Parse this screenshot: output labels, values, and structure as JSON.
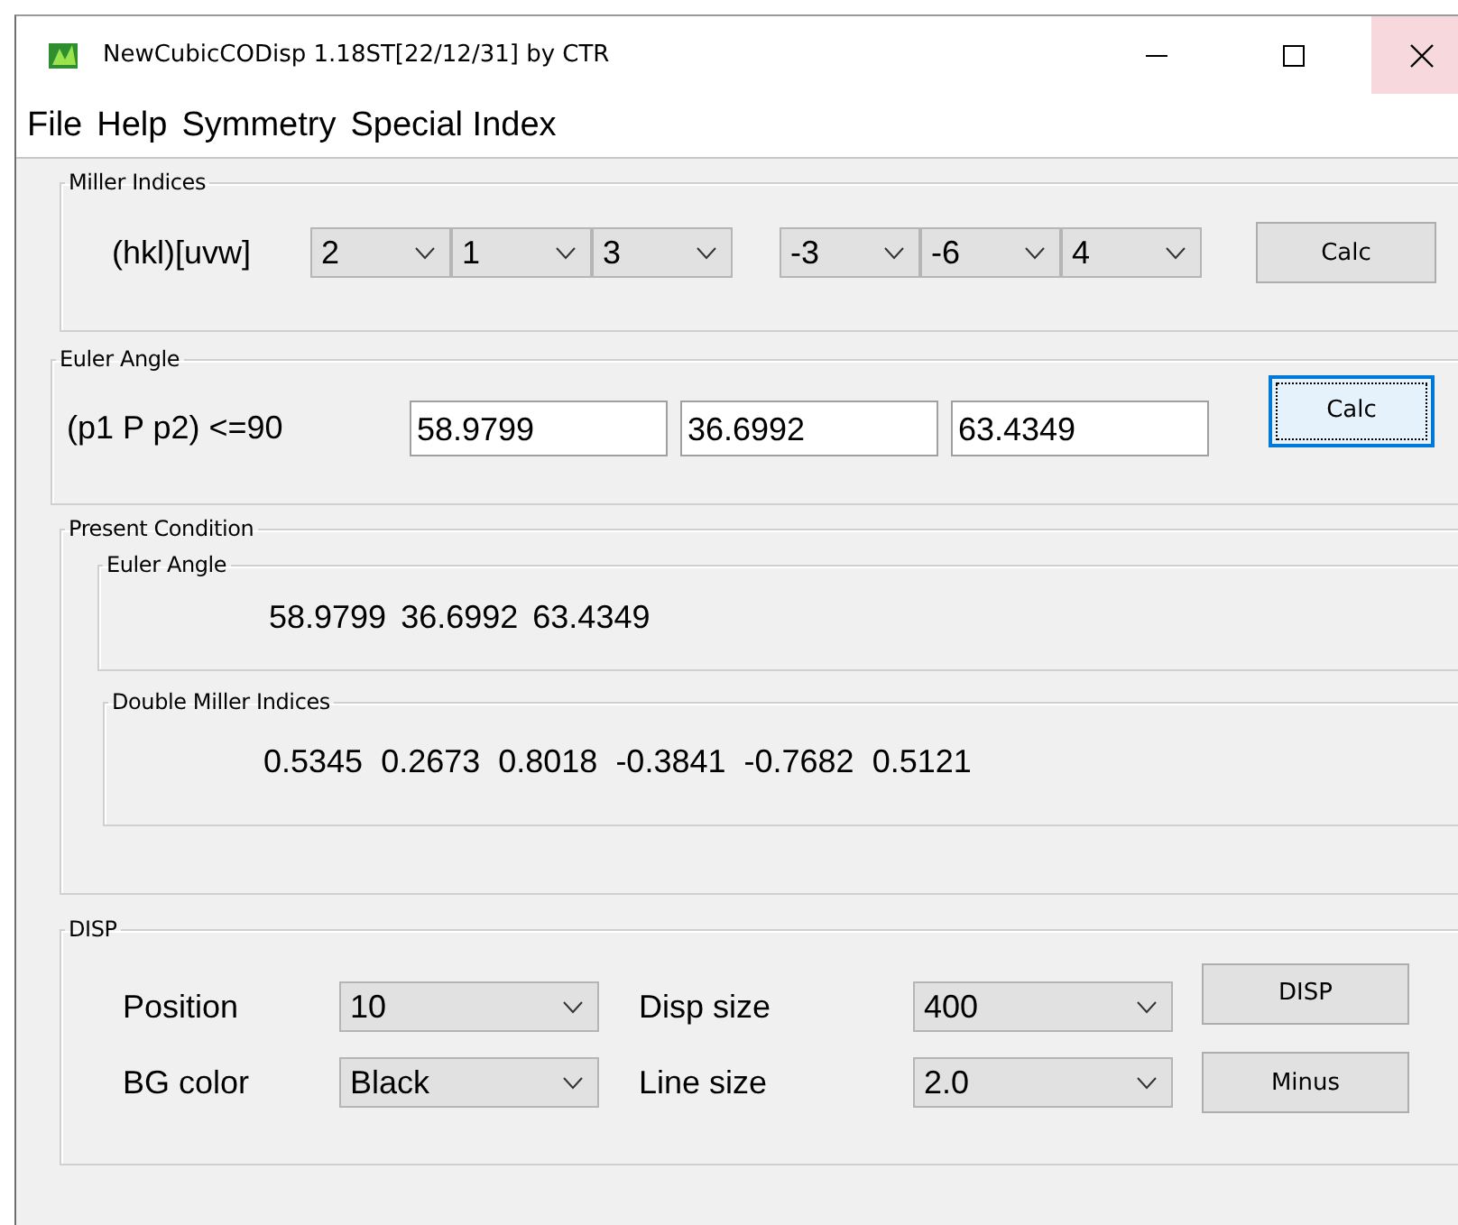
{
  "window": {
    "title": "NewCubicCODisp 1.18ST[22/12/31] by CTR",
    "controls": [
      {
        "kind": "minimize",
        "hovered": false
      },
      {
        "kind": "maximize",
        "hovered": false
      },
      {
        "kind": "close",
        "hovered": true
      }
    ]
  },
  "menu": [
    "File",
    "Help",
    "Symmetry",
    "Special Index"
  ],
  "miller_indices": {
    "title": "Miller Indices",
    "label": "(hkl)[uvw]",
    "hkl": [
      "2",
      "1",
      "3"
    ],
    "uvw": [
      "-3",
      "-6",
      "4"
    ],
    "calc_button": {
      "label": "Calc",
      "focused": false
    }
  },
  "euler_angle": {
    "title": "Euler Angle",
    "label": "(p1 P p2) <=90",
    "inputs": [
      "58.9799",
      "36.6992",
      "63.4349"
    ],
    "calc_button": {
      "label": "Calc",
      "focused": true
    }
  },
  "present_condition": {
    "title": "Present Condition",
    "euler_angle": {
      "title": "Euler Angle",
      "values": [
        "58.9799",
        "36.6992",
        "63.4349"
      ]
    },
    "double_miller_indices": {
      "title": "Double Miller Indices",
      "values": [
        "0.5345",
        "0.2673",
        "0.8018",
        "-0.3841",
        "-0.7682",
        "0.5121"
      ]
    }
  },
  "disp": {
    "title": "DISP",
    "rows": [
      {
        "label": "Position",
        "value": "10",
        "label_2": "Disp size",
        "value_2": "400",
        "button": "DISP"
      },
      {
        "label": "BG color",
        "value": "Black",
        "label_2": "Line size",
        "value_2": "2.0",
        "button": "Minus"
      }
    ]
  }
}
